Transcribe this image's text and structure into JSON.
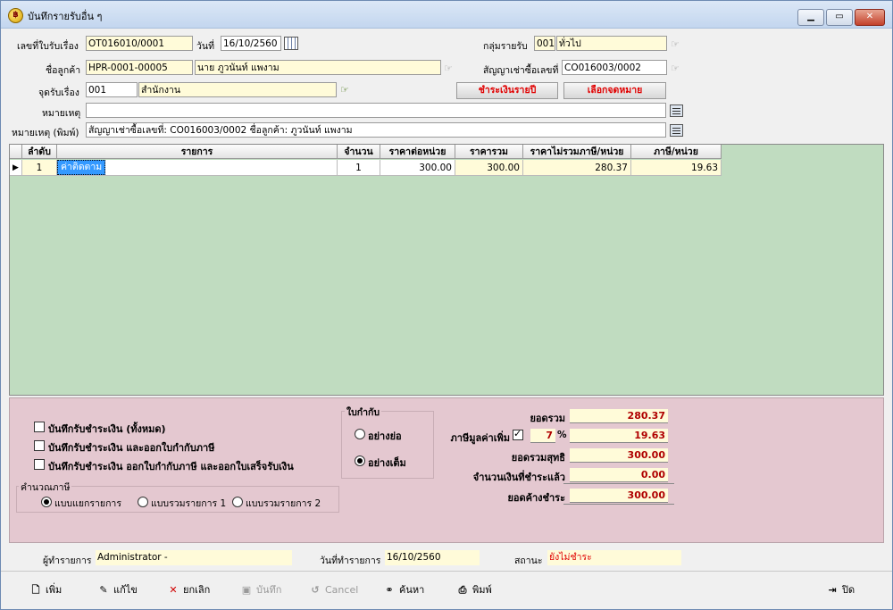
{
  "window": {
    "title": "บันทึกรายรับอื่น ๆ",
    "minimize": "▁",
    "maximize": "▭",
    "close": "✕"
  },
  "header": {
    "doc_no_label": "เลขที่ใบรับเรื่อง",
    "doc_no": "OT016010/0001",
    "date_label": "วันที่",
    "date": "16/10/2560",
    "group_label": "กลุ่มรายรับ",
    "group_code": "001",
    "group_name": "ทั่วไป",
    "customer_label": "ชื่อลูกค้า",
    "customer_code": "HPR-0001-00005",
    "customer_name": "นาย ภูวนันท์ แพงาม",
    "contract_label": "สัญญาเช่าซื้อเลขที่",
    "contract_no": "CO016003/0002",
    "point_label": "จุดรับเรื่อง",
    "point_code": "001",
    "point_name": "สำนักงาน",
    "pay_yearly_btn": "ชำระเงินรายปี",
    "choose_btn": "เลือกจดหมาย",
    "remark_label": "หมายเหตุ",
    "remark": "",
    "remark_print_label": "หมายเหตุ (พิมพ์)",
    "remark_print": "สัญญาเช่าซื้อเลขที่: CO016003/0002 ชื่อลูกค้า: ภูวนันท์ แพงาม"
  },
  "grid": {
    "columns": [
      "ลำดับ",
      "รายการ",
      "จำนวน",
      "ราคาต่อหน่วย",
      "ราคารวม",
      "ราคาไม่รวมภาษี/หน่วย",
      "ภาษี/หน่วย"
    ],
    "rows": [
      {
        "no": "1",
        "item": "ค่าติดตาม",
        "qty": "1",
        "unit_price": "300.00",
        "total": "300.00",
        "price_ex_vat": "280.37",
        "vat": "19.63"
      }
    ]
  },
  "options": {
    "save_pay_all": "บันทึกรับชำระเงิน (ทั้งหมด)",
    "save_pay_tax": "บันทึกรับชำระเงิน และออกใบกำกับภาษี",
    "save_pay_tax_receipt": "บันทึกรับชำระเงิน ออกใบกำกับภาษี และออกใบเสร็จรับเงิน",
    "tax_calc_label": "คำนวณภาษี",
    "tax_calc_options": [
      "แบบแยกรายการ",
      "แบบรวมรายการ 1",
      "แบบรวมรายการ 2"
    ],
    "invoice_label": "ใบกำกับ",
    "invoice_options": [
      "อย่างย่อ",
      "อย่างเต็ม"
    ]
  },
  "summary": {
    "total_label": "ยอดรวม",
    "total": "280.37",
    "vat_label": "ภาษีมูลค่าเพิ่ม",
    "vat_rate": "7",
    "vat_unit": "%",
    "vat": "19.63",
    "net_label": "ยอดรวมสุทธิ",
    "net": "300.00",
    "paid_label": "จำนวนเงินที่ชำระแล้ว",
    "paid": "0.00",
    "outstanding_label": "ยอดค้างชำระ",
    "outstanding": "300.00"
  },
  "status": {
    "user_label": "ผู้ทำรายการ",
    "user": "Administrator -",
    "date_label": "วันที่ทำรายการ",
    "date": "16/10/2560",
    "state_label": "สถานะ",
    "state": "ยังไม่ชำระ"
  },
  "toolbar": {
    "add": "เพิ่ม",
    "edit": "แก้ไข",
    "cancel_doc": "ยกเลิก",
    "save": "บันทึก",
    "cancel": "Cancel",
    "search": "ค้นหา",
    "print": "พิมพ์",
    "close": "ปิด"
  },
  "colors": {
    "field_bg": "#fffbd9",
    "grid_bg": "#c0dcc0",
    "panel_bg": "#e4c8d0",
    "red_text": "#e00000",
    "selection": "#3399ff"
  }
}
